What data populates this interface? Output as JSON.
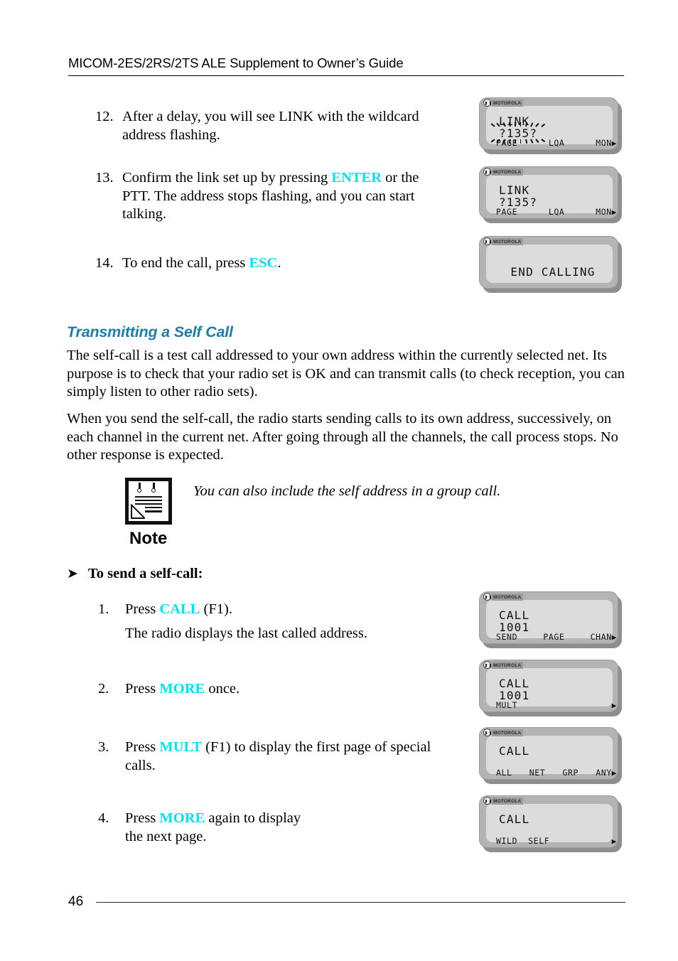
{
  "header": {
    "title": "MICOM-2ES/2RS/2TS ALE Supplement to Owner’s Guide"
  },
  "steps_top": [
    {
      "num": "12.",
      "text_1": "After a delay, you will see LINK with the wildcard",
      "text_2": "address flashing."
    },
    {
      "num": "13.",
      "text_a": "Confirm the link set up by pressing ",
      "key": "ENTER",
      "text_b": " or the",
      "text_2": "PTT. The address stops flashing, and you can start",
      "text_3": "talking."
    },
    {
      "num": "14.",
      "text_a": "To end the call, press ",
      "key": "ESC",
      "text_b": "."
    }
  ],
  "section": {
    "heading": "Transmitting a Self Call",
    "para1": "The self-call is a test call addressed to your own address within the currently selected net. Its purpose is to check that your radio set is OK and can transmit calls (to check reception, you can simply listen to other radio sets).",
    "para2": "When you send the self-call, the radio starts sending calls to its own address, successively, on each channel in the current net. After going through all the channels, the call process stops. No other response is expected."
  },
  "note": {
    "label": "Note",
    "text": "You can also include the self address in a group call.",
    "icon": "notepad-icon"
  },
  "procedure": {
    "arrow": "➤",
    "title": "To send a self-call:",
    "steps": [
      {
        "num": "1.",
        "text_a": "Press ",
        "key": "CALL",
        "text_b": " (F1).",
        "text_2": "The radio displays the last called address."
      },
      {
        "num": "2.",
        "text_a": "Press ",
        "key": "MORE",
        "text_b": " once."
      },
      {
        "num": "3.",
        "text_a": "Press ",
        "key": "MULT",
        "text_b": " (F1) to display the first page of special",
        "text_2": "calls."
      },
      {
        "num": "4.",
        "text_a": "Press ",
        "key": "MORE",
        "text_b": " again to display",
        "text_2": "the next page."
      }
    ]
  },
  "displays": [
    {
      "id": "lcd-link-flashing",
      "brand": "MOTOROLA",
      "line1": "LINK",
      "line2": "?135?",
      "line2_flashing": true,
      "softkeys": [
        "PAGE",
        "LQA",
        "MON"
      ],
      "arrow": "▶",
      "centered": false
    },
    {
      "id": "lcd-link-steady",
      "brand": "MOTOROLA",
      "line1": "LINK",
      "line2": "?135?",
      "line2_flashing": false,
      "softkeys": [
        "PAGE",
        "LQA",
        "MON"
      ],
      "arrow": "▶",
      "centered": false
    },
    {
      "id": "lcd-end-calling",
      "brand": "MOTOROLA",
      "line1": "",
      "line2": "END CALLING",
      "line2_flashing": false,
      "softkeys": [],
      "arrow": "",
      "centered": true
    },
    {
      "id": "lcd-call-1001-send",
      "brand": "MOTOROLA",
      "line1": "CALL",
      "line2": "1001",
      "line2_flashing": false,
      "softkeys": [
        "SEND",
        "PAGE",
        "CHAN"
      ],
      "arrow": "▶",
      "centered": false
    },
    {
      "id": "lcd-call-1001-mult",
      "brand": "MOTOROLA",
      "line1": "CALL",
      "line2": "1001",
      "line2_flashing": false,
      "softkeys": [
        "MULT"
      ],
      "arrow": "▶",
      "centered": false
    },
    {
      "id": "lcd-call-all-net-grp-any",
      "brand": "MOTOROLA",
      "line1": "CALL",
      "line2": "",
      "line2_flashing": false,
      "softkeys": [
        "ALL",
        "NET",
        "GRP",
        "ANY"
      ],
      "arrow": "▶",
      "centered": false
    },
    {
      "id": "lcd-call-wild-self",
      "brand": "MOTOROLA",
      "line1": "CALL",
      "line2": "",
      "line2_flashing": false,
      "softkeys": [
        "WILD",
        "SELF"
      ],
      "arrow": "▶",
      "centered": false
    }
  ],
  "footer": {
    "page_number": "46"
  },
  "colors": {
    "key_accent": "#00e5f0",
    "heading": "#1a7fad",
    "lcd_bezel": "#b4b4b4",
    "lcd_screen": "#dcdcdc",
    "lcd_shadow": "#8e8e8e"
  }
}
